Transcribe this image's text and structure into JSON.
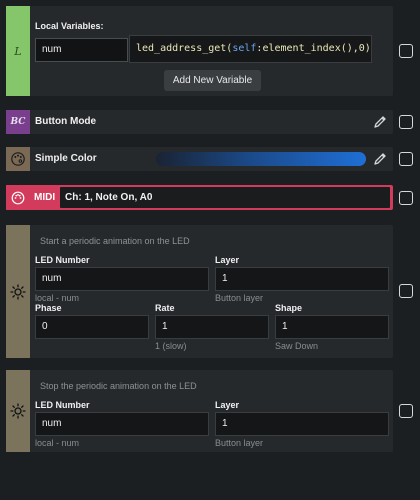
{
  "locals": {
    "title": "Local Variables:",
    "name": "num",
    "expr_fn": "led_address_get(",
    "expr_self": "self",
    "expr_rest": ":element_index(),0)",
    "add_label": "Add New Variable",
    "badge": "L",
    "color": "#86c66a"
  },
  "button_mode": {
    "badge": "BC",
    "label": "Button Mode",
    "color": "#7a3f8c"
  },
  "simple_color": {
    "label": "Simple Color",
    "color": "#7a6a55",
    "swatch": "#1f6ac4"
  },
  "midi": {
    "label": "MIDI",
    "value": "Ch: 1, Note On, A0",
    "color": "#d23b5c"
  },
  "anim_start": {
    "note": "Start a periodic animation on the LED",
    "led_label": "LED Number",
    "led_value": "num",
    "led_help": "local - num",
    "layer_label": "Layer",
    "layer_value": "1",
    "layer_help": "Button layer",
    "phase_label": "Phase",
    "phase_value": "0",
    "rate_label": "Rate",
    "rate_value": "1",
    "rate_help": "1 (slow)",
    "shape_label": "Shape",
    "shape_value": "1",
    "shape_help": "Saw Down",
    "color": "#7c735c"
  },
  "anim_stop": {
    "note": "Stop the periodic animation on the LED",
    "led_label": "LED Number",
    "led_value": "num",
    "led_help": "local - num",
    "layer_label": "Layer",
    "layer_value": "1",
    "layer_help": "Button layer",
    "color": "#7c735c"
  }
}
